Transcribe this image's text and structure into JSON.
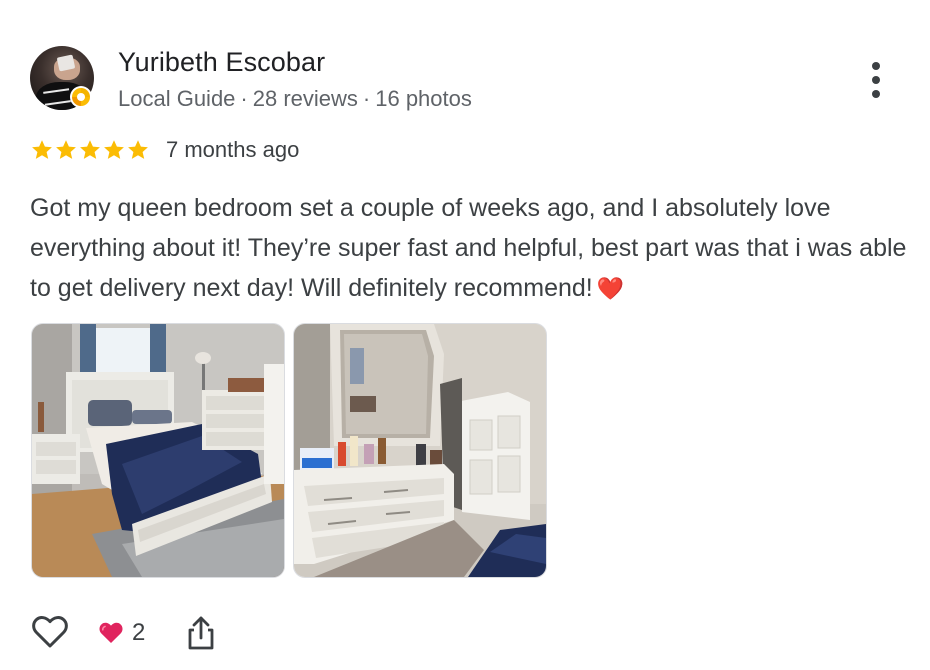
{
  "reviewer": {
    "name": "Yuribeth Escobar",
    "badge": "Local Guide",
    "separator": "·",
    "reviews": "28 reviews",
    "photos": "16 photos",
    "guide_badge_color": "#fbbc04"
  },
  "rating": {
    "stars": 5,
    "max_stars": 5,
    "star_color": "#fbbc04",
    "date": "7 months ago"
  },
  "review": {
    "text": "Got my queen bedroom set a couple of weeks ago, and I absolutely love everything about it! They’re super fast and helpful, best part was that i was able to get delivery next day! Will definitely recommend!",
    "emoji": "❤️"
  },
  "photos": [
    {
      "subject": "bed-with-blue-blanket"
    },
    {
      "subject": "dresser-with-mirror"
    }
  ],
  "actions": {
    "reaction_count": "2",
    "reaction_color": "#e0245e",
    "icons": [
      "heart-outline-icon",
      "heart-icon",
      "share-icon",
      "more-vert-icon"
    ]
  }
}
